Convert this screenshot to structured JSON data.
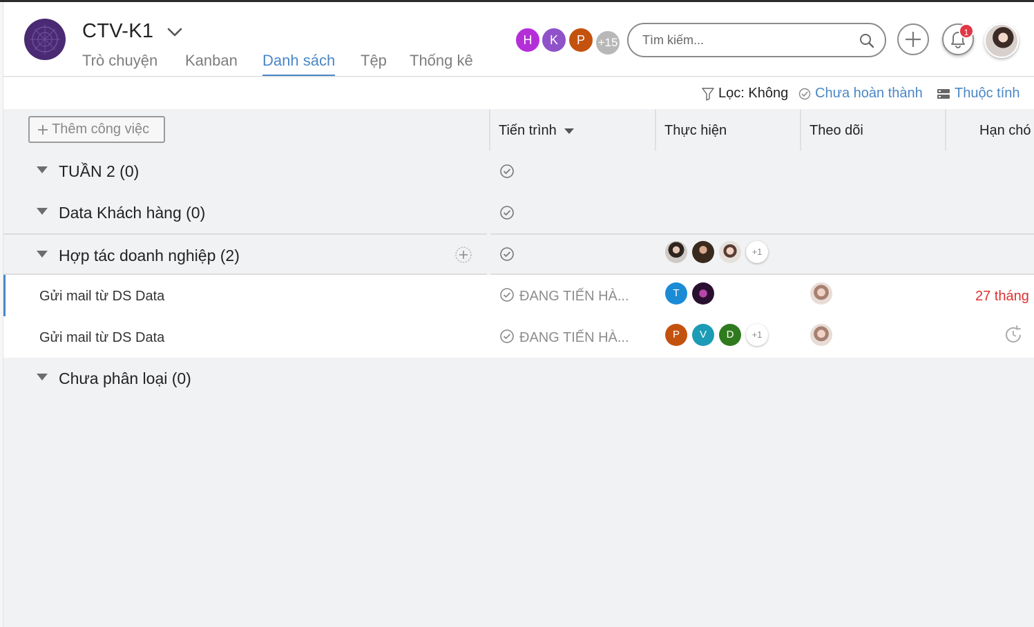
{
  "project": {
    "name": "CTV-K1",
    "tabs": [
      {
        "label": "Trò chuyện",
        "active": false
      },
      {
        "label": "Kanban",
        "active": false
      },
      {
        "label": "Danh sách",
        "active": true
      },
      {
        "label": "Tệp",
        "active": false
      },
      {
        "label": "Thống kê",
        "active": false
      }
    ]
  },
  "members": {
    "avatars": [
      {
        "initial": "H",
        "color": "#b42fd8"
      },
      {
        "initial": "K",
        "color": "#8f52c9"
      },
      {
        "initial": "P",
        "color": "#c4520f"
      }
    ],
    "more": "+15",
    "more_color": "#b8b8b8"
  },
  "search": {
    "placeholder": "Tìm kiếm..."
  },
  "notifications": {
    "count": "1"
  },
  "filterbar": {
    "filter_label": "Lọc: Không",
    "status_label": "Chưa hoàn thành",
    "properties_label": "Thuộc tính"
  },
  "table": {
    "add_task_label": "Thêm công việc",
    "columns": {
      "progress": "Tiến trình",
      "assignee": "Thực hiện",
      "follower": "Theo dõi",
      "due": "Hạn chó"
    }
  },
  "groups": [
    {
      "title": "TUẦN 2 (0)"
    },
    {
      "title": "Data Khách hàng (0)"
    },
    {
      "title": "Hợp tác doanh nghiệp (2)",
      "assignee_more": "+1"
    },
    {
      "title": "Chưa phân loại (0)"
    }
  ],
  "tasks": [
    {
      "name": "Gửi mail từ DS Data",
      "status": "ĐANG TIẾN HÀ...",
      "assignees": [
        {
          "initial": "T",
          "color": "#1b8bd6"
        }
      ],
      "due": "27 tháng"
    },
    {
      "name": "Gửi mail từ DS Data",
      "status": "ĐANG TIẾN HÀ...",
      "assignees": [
        {
          "initial": "P",
          "color": "#c4520f"
        },
        {
          "initial": "V",
          "color": "#1b9bb5"
        },
        {
          "initial": "D",
          "color": "#2f7a1e"
        }
      ],
      "assignee_more": "+1"
    }
  ],
  "colors": {
    "accent": "#4a87c6",
    "due_overdue": "#e02f2f",
    "badge": "#e23645"
  }
}
